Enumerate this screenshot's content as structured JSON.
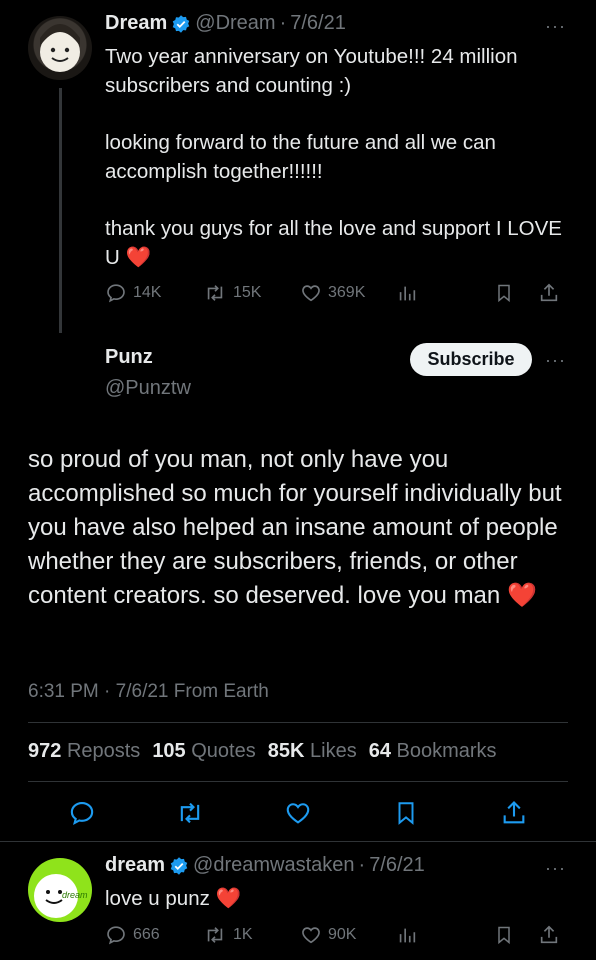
{
  "parent_tweet": {
    "name": "Dream",
    "handle": "@Dream",
    "date": "7/6/21",
    "lines": [
      "Two year anniversary on Youtube!!! 24 million subscribers and counting :)",
      "looking forward to the future and all we can accomplish together!!!!!!",
      "thank you guys for all the love and support I LOVE U"
    ],
    "heart_emoji": "❤️",
    "replies": "14K",
    "reposts": "15K",
    "likes": "369K",
    "more": "···"
  },
  "main_tweet": {
    "name": "Punz",
    "handle": "@Punztw",
    "subscribe_label": "Subscribe",
    "more": "···",
    "text": "so proud of you man, not only have you accomplished so much for yourself individually but you have also helped an insane amount of people whether they are subscribers, friends, or other content creators. so deserved. love you man",
    "heart_emoji": "❤️",
    "time": "6:31 PM",
    "date": "7/6/21",
    "source": "From Earth",
    "stats": {
      "reposts_count": "972",
      "reposts_label": "Reposts",
      "quotes_count": "105",
      "quotes_label": "Quotes",
      "likes_count": "85K",
      "likes_label": "Likes",
      "bookmarks_count": "64",
      "bookmarks_label": "Bookmarks"
    }
  },
  "reply_tweet": {
    "name": "dream",
    "handle": "@dreamwastaken",
    "date": "7/6/21",
    "text": "love u punz",
    "heart_emoji": "❤️",
    "replies": "666",
    "reposts": "1K",
    "likes": "90K",
    "avatar_label": "dream",
    "more": "···"
  },
  "colors": {
    "background": "#000000",
    "text": "#e7e9ea",
    "muted": "#71767b",
    "verified": "#1d9bf0",
    "heart": "#f91880",
    "avatar_green": "#8fe31b"
  }
}
